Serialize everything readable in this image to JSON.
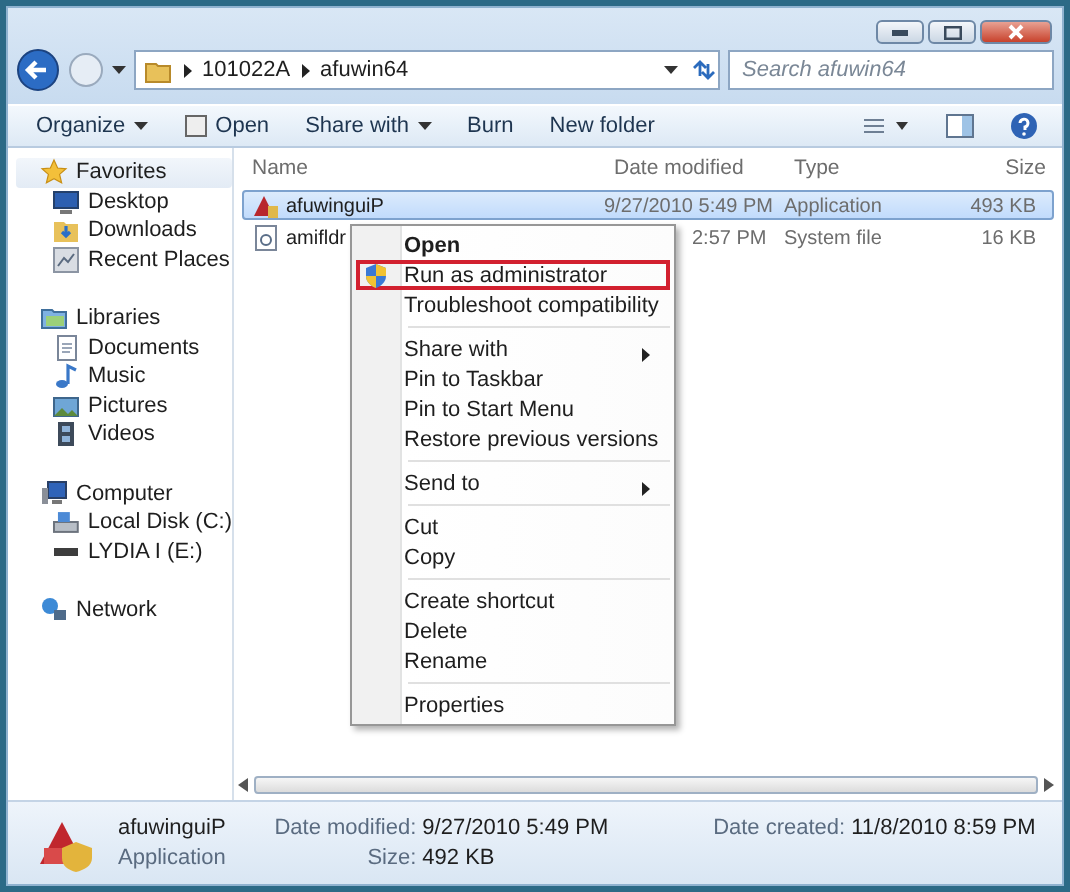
{
  "address": {
    "crumbs": [
      "101022A",
      "afuwin64"
    ]
  },
  "search": {
    "placeholder": "Search afuwin64"
  },
  "toolbar": [
    {
      "label": "Organize",
      "dropdown": true
    },
    {
      "label": "Open",
      "dropdown": false
    },
    {
      "label": "Share with",
      "dropdown": true
    },
    {
      "label": "Burn",
      "dropdown": false
    },
    {
      "label": "New folder",
      "dropdown": false
    }
  ],
  "sidebar": [
    {
      "label": "Favorites",
      "selected": true,
      "children": [
        {
          "label": "Desktop"
        },
        {
          "label": "Downloads"
        },
        {
          "label": "Recent Places"
        }
      ]
    },
    {
      "label": "Libraries",
      "selected": false,
      "children": [
        {
          "label": "Documents"
        },
        {
          "label": "Music"
        },
        {
          "label": "Pictures"
        },
        {
          "label": "Videos"
        }
      ]
    },
    {
      "label": "Computer",
      "selected": false,
      "children": [
        {
          "label": "Local Disk (C:)"
        },
        {
          "label": "LYDIA I (E:)"
        }
      ]
    },
    {
      "label": "Network",
      "selected": false
    }
  ],
  "table": {
    "columns": [
      "Name",
      "Date modified",
      "Type",
      "Size"
    ],
    "rows": [
      {
        "name": "afuwinguiP",
        "date": "9/27/2010 5:49 PM",
        "type": "Application",
        "size": "493 KB",
        "selected": true
      },
      {
        "name": "amifldr",
        "date": "2:57 PM",
        "type": "System file",
        "size": "16 KB",
        "selected": false
      }
    ]
  },
  "context_menu": [
    {
      "kind": "item",
      "label": "Open",
      "default": true,
      "highlighted": false,
      "submenu": false
    },
    {
      "kind": "item",
      "label": "Run as administrator",
      "default": false,
      "highlighted": true,
      "submenu": false
    },
    {
      "kind": "item",
      "label": "Troubleshoot compatibility",
      "default": false,
      "highlighted": false,
      "submenu": false
    },
    {
      "kind": "separator"
    },
    {
      "kind": "item",
      "label": "Share with",
      "default": false,
      "highlighted": false,
      "submenu": true
    },
    {
      "kind": "item",
      "label": "Pin to Taskbar",
      "default": false,
      "highlighted": false,
      "submenu": false
    },
    {
      "kind": "item",
      "label": "Pin to Start Menu",
      "default": false,
      "highlighted": false,
      "submenu": false
    },
    {
      "kind": "item",
      "label": "Restore previous versions",
      "default": false,
      "highlighted": false,
      "submenu": false
    },
    {
      "kind": "separator"
    },
    {
      "kind": "item",
      "label": "Send to",
      "default": false,
      "highlighted": false,
      "submenu": true
    },
    {
      "kind": "separator"
    },
    {
      "kind": "item",
      "label": "Cut",
      "default": false,
      "highlighted": false,
      "submenu": false
    },
    {
      "kind": "item",
      "label": "Copy",
      "default": false,
      "highlighted": false,
      "submenu": false
    },
    {
      "kind": "separator"
    },
    {
      "kind": "item",
      "label": "Create shortcut",
      "default": false,
      "highlighted": false,
      "submenu": false
    },
    {
      "kind": "item",
      "label": "Delete",
      "default": false,
      "highlighted": false,
      "submenu": false
    },
    {
      "kind": "item",
      "label": "Rename",
      "default": false,
      "highlighted": false,
      "submenu": false
    },
    {
      "kind": "separator"
    },
    {
      "kind": "item",
      "label": "Properties",
      "default": false,
      "highlighted": false,
      "submenu": false
    }
  ],
  "details": {
    "name": "afuwinguiP",
    "type": "Application",
    "fields": [
      {
        "label": "Date modified:",
        "value": "9/27/2010 5:49 PM"
      },
      {
        "label": "Date created:",
        "value": "11/8/2010 8:59 PM"
      },
      {
        "label": "Size:",
        "value": "492 KB"
      }
    ]
  }
}
